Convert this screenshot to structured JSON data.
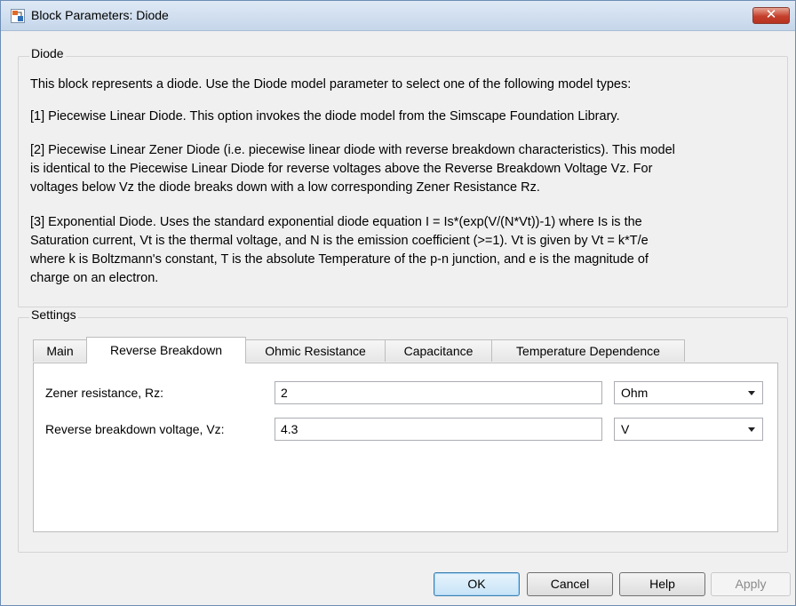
{
  "window": {
    "title": "Block Parameters: Diode",
    "close_label": "✕"
  },
  "diode_group": {
    "label": "Diode",
    "paragraphs": [
      "This block represents a diode. Use the Diode model parameter to select one of the following model types:",
      "[1] Piecewise Linear Diode. This option invokes the diode model from the Simscape Foundation Library.",
      "[2] Piecewise Linear Zener Diode (i.e. piecewise linear diode with reverse breakdown characteristics). This model",
      "is identical to the Piecewise Linear Diode for reverse voltages above the Reverse Breakdown Voltage Vz. For",
      "voltages below Vz the diode breaks down with a low corresponding Zener Resistance Rz.",
      "[3] Exponential Diode. Uses the standard exponential diode equation I = Is*(exp(V/(N*Vt))-1) where Is is the",
      "Saturation current, Vt is the thermal voltage, and N is the emission coefficient (>=1). Vt is given by Vt = k*T/e",
      "where k is Boltzmann's constant, T is the absolute Temperature of the p-n junction, and e is the magnitude of",
      "charge on an electron."
    ]
  },
  "settings_group": {
    "label": "Settings",
    "tabs": [
      {
        "label": "Main"
      },
      {
        "label": "Reverse Breakdown",
        "active": true
      },
      {
        "label": "Ohmic Resistance"
      },
      {
        "label": "Capacitance"
      },
      {
        "label": "Temperature Dependence"
      }
    ],
    "params": [
      {
        "label": "Zener resistance, Rz:",
        "value": "2",
        "unit": "Ohm"
      },
      {
        "label": "Reverse breakdown voltage, Vz:",
        "value": "4.3",
        "unit": "V"
      }
    ]
  },
  "buttons": {
    "ok": "OK",
    "cancel": "Cancel",
    "help": "Help",
    "apply": "Apply"
  },
  "colors": {
    "close_button": "#c4402c",
    "window_bg": "#f0f0f0",
    "title_bar": "#dfe9f5"
  }
}
